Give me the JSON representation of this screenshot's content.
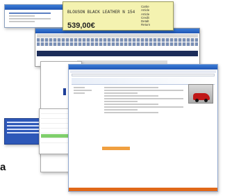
{
  "yellow_window": {
    "item_text": "BLOUSON BLACK LEATHER N 154",
    "price": "539,00€",
    "menu_items": [
      "Cartie",
      "Article",
      "Article",
      "Credit",
      "Detalt",
      "Return"
    ]
  },
  "logo_text": "a",
  "colors": {
    "titlebar": "#1f55b4",
    "yellow_bg": "#f4f2b0",
    "footer_orange": "#e06818",
    "selected_green": "#7fcf6b",
    "car_red": "#c01818"
  }
}
